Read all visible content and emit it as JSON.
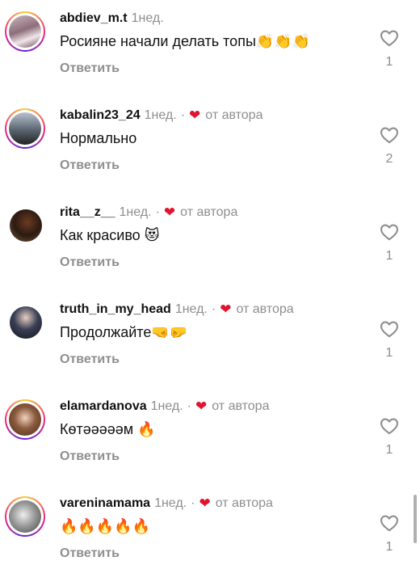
{
  "comments": [
    {
      "username": "abdiev_m.t",
      "time": "1нед.",
      "text": "Росияне начали делать топы",
      "emoji": "👏👏👏",
      "likes": "1",
      "reply": "Ответить",
      "from_author": false
    },
    {
      "username": "kabalin23_24",
      "time": "1нед.",
      "author_label": "от автора",
      "text": "Нормально",
      "emoji": "",
      "likes": "2",
      "reply": "Ответить",
      "from_author": true
    },
    {
      "username": "rita__z__",
      "time": "1нед.",
      "author_label": "от автора",
      "text": "Как красиво",
      "emoji": "😻",
      "likes": "1",
      "reply": "Ответить",
      "from_author": true
    },
    {
      "username": "truth_in_my_head",
      "time": "1нед.",
      "author_label": "от автора",
      "text": "Продолжайте",
      "emoji": "🤜🤛",
      "likes": "1",
      "reply": "Ответить",
      "from_author": true
    },
    {
      "username": "elamardanova",
      "time": "1нед.",
      "author_label": "от автора",
      "text": "Кѳтәәәәәм",
      "emoji": "🔥",
      "likes": "1",
      "reply": "Ответить",
      "from_author": true
    },
    {
      "username": "vareninamama",
      "time": "1нед.",
      "author_label": "от автора",
      "text": "",
      "emoji": "🔥🔥🔥🔥🔥",
      "likes": "1",
      "reply": "Ответить",
      "from_author": true
    }
  ],
  "separator": "·",
  "author_heart": "❤"
}
